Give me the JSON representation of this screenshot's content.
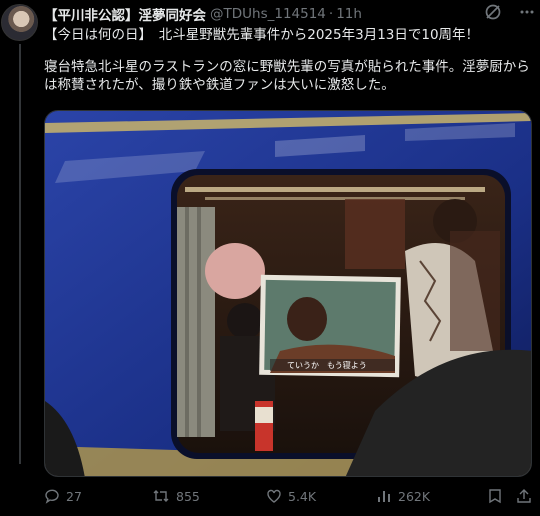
{
  "tweet": {
    "display_name": "【平川非公認】淫夢同好会",
    "handle": "@TDUhs_114514",
    "separator": "·",
    "time": "11h",
    "line1": "【今日は何の日】　北斗星野獣先輩事件から2025年3月13日で10周年！",
    "paragraph2": "寝台特急北斗星のラストランの窓に野獣先輩の写真が貼られた事件。淫夢厨からは称賛されたが、撮り鉄や鉄道ファンは大いに激怒した。",
    "photo_caption": "ていうか　もう寝よう"
  },
  "actions": {
    "replies": "27",
    "reposts": "855",
    "likes": "5.4K",
    "views": "262K"
  },
  "icons": [
    "grok-icon",
    "more-icon",
    "reply-icon",
    "repost-icon",
    "like-icon",
    "views-icon",
    "bookmark-icon",
    "share-icon"
  ]
}
